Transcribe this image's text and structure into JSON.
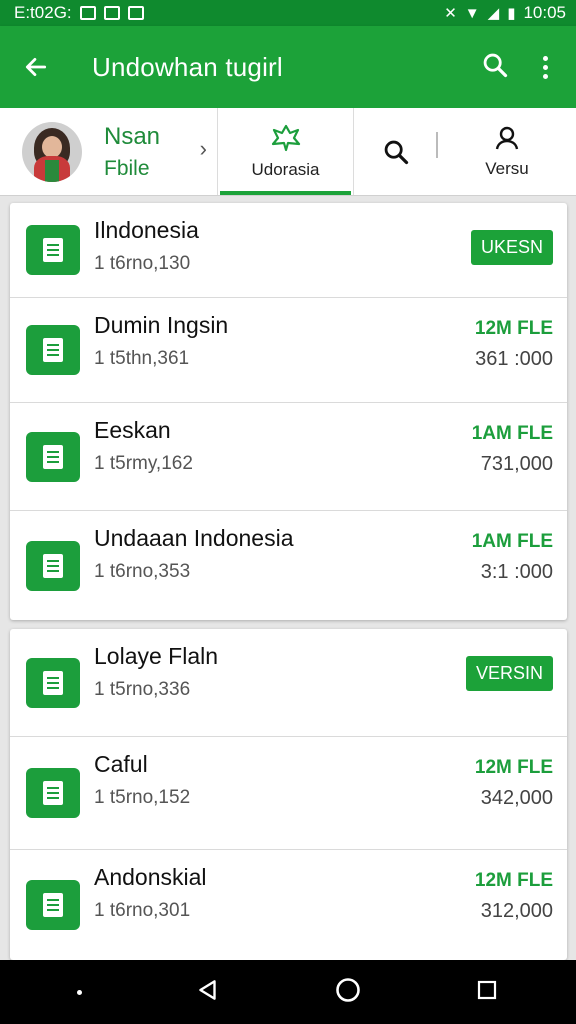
{
  "status_bar": {
    "left_text": "E:t02G:",
    "time": "10:05"
  },
  "app_bar": {
    "title": "Undowhan tugirl"
  },
  "profile": {
    "name": "Nsan",
    "subtitle": "Fbile"
  },
  "tabs": [
    {
      "label": "Udorasia"
    },
    {
      "label": ""
    },
    {
      "label": "Versu"
    }
  ],
  "list_group_1": [
    {
      "title": "Ilndonesia",
      "subtitle": "1 t6rno,130",
      "badge": "UKESN"
    },
    {
      "title": "Dumin Ingsin",
      "subtitle": "1 t5thn,361",
      "top": "12M FLE",
      "bottom": "361 :000"
    },
    {
      "title": "Eeskan",
      "subtitle": "1 t5rmy,162",
      "top": "1AM FLE",
      "bottom": "731,000"
    },
    {
      "title": "Undaaan Indonesia",
      "subtitle": "1 t6rno,353",
      "top": "1AM FLE",
      "bottom": "3:1 :000"
    }
  ],
  "list_group_2": [
    {
      "title": "Lolaye Flaln",
      "subtitle": "1 t5rno,336",
      "badge": "VERSIN"
    },
    {
      "title": "Caful",
      "subtitle": "1 t5rno,152",
      "top": "12M FLE",
      "bottom": "342,000"
    },
    {
      "title": "Andonskial",
      "subtitle": "1 t6rno,301",
      "top": "12M FLE",
      "bottom": "312,000"
    }
  ],
  "colors": {
    "status_bar": "#0f8a2e",
    "app_bar": "#1ca239",
    "accent": "#1c9e3c"
  },
  "icons": [
    "back-arrow-icon",
    "search-icon",
    "more-vert-icon",
    "leaf-icon",
    "search-icon",
    "user-icon",
    "document-icon",
    "back-triangle-icon",
    "home-circle-icon",
    "recents-square-icon"
  ]
}
